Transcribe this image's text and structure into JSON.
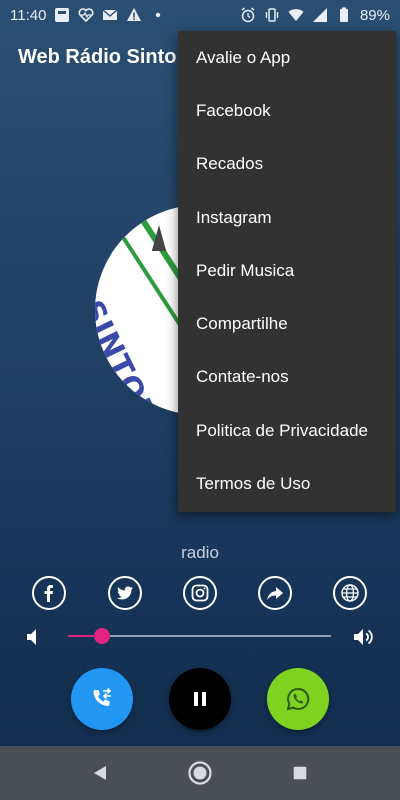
{
  "status_bar": {
    "time": "11:40",
    "battery": "89%",
    "left_icons": [
      "notification-app-icon",
      "heart-monitor-icon",
      "mail-icon",
      "warning-icon",
      "dot-icon"
    ],
    "right_icons": [
      "alarm-icon",
      "vibrate-icon",
      "wifi-icon",
      "signal-icon",
      "battery-icon"
    ]
  },
  "app_bar": {
    "title": "Web Rádio Sinto"
  },
  "logo": {
    "text": "SINTONIZA CONSCIÊ"
  },
  "menu": {
    "items": [
      {
        "label": "Avalie o App"
      },
      {
        "label": "Facebook"
      },
      {
        "label": "Recados"
      },
      {
        "label": "Instagram"
      },
      {
        "label": "Pedir Musica"
      },
      {
        "label": "Compartilhe"
      },
      {
        "label": "Contate-nos"
      },
      {
        "label": "Politica de Privacidade"
      },
      {
        "label": "Termos de Uso"
      }
    ]
  },
  "player": {
    "station_label": "radio",
    "volume_level": 0.13,
    "social": [
      {
        "icon": "facebook-icon"
      },
      {
        "icon": "twitter-icon"
      },
      {
        "icon": "instagram-icon"
      },
      {
        "icon": "share-icon"
      },
      {
        "icon": "globe-icon"
      }
    ],
    "buttons": [
      {
        "icon": "phone-transfer-icon",
        "color": "#2196f3"
      },
      {
        "icon": "pause-icon",
        "color": "#000000"
      },
      {
        "icon": "whatsapp-icon",
        "color": "#7ed321"
      }
    ]
  },
  "colors": {
    "accent": "#e2237f",
    "menu_bg": "#323232",
    "nav_bg": "#4a4f55"
  }
}
